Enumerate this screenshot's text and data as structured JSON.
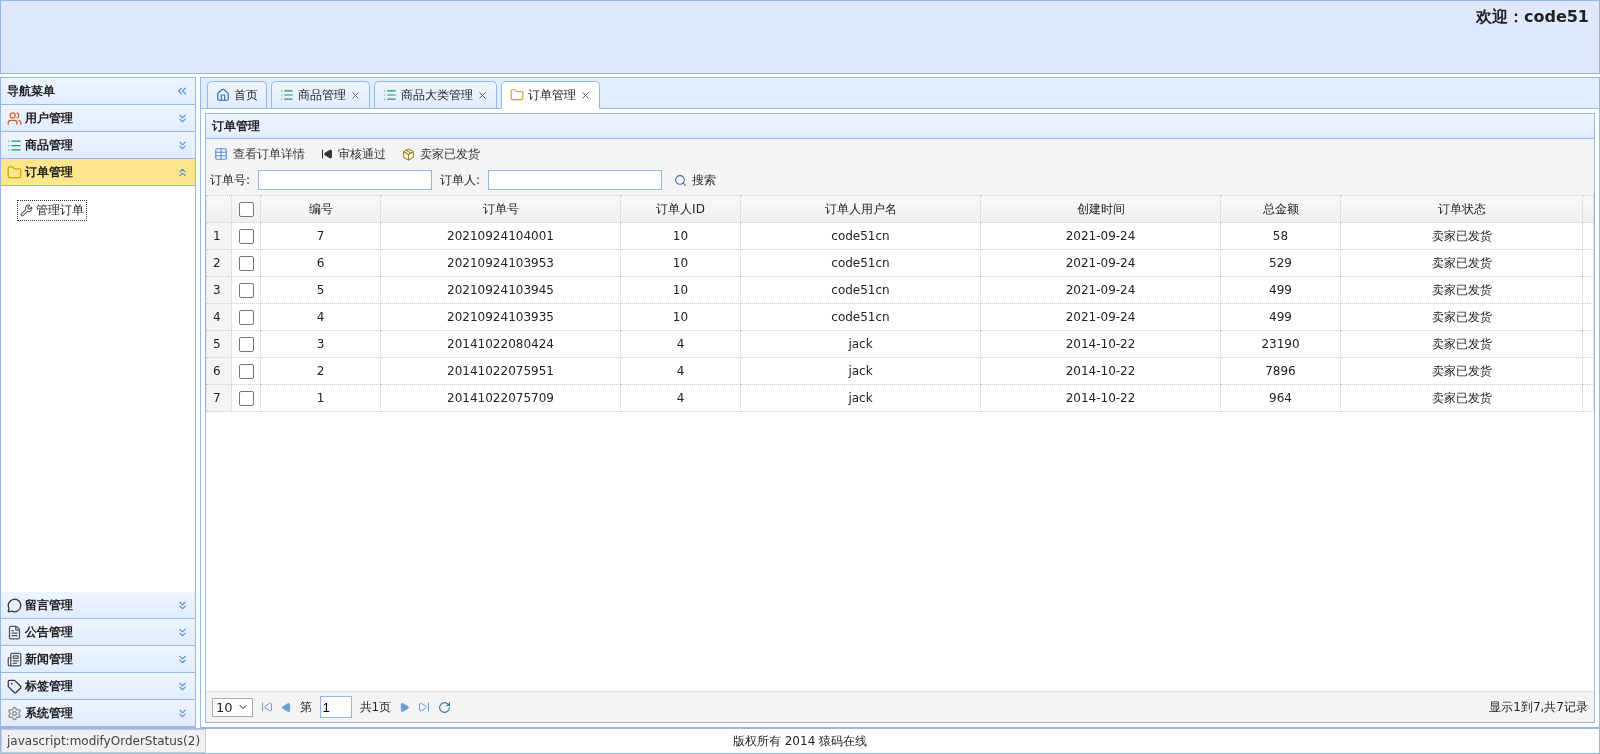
{
  "header": {
    "welcome": "欢迎：code51"
  },
  "sidebar": {
    "title": "导航菜单",
    "sections": [
      {
        "label": "用户管理",
        "expanded": false
      },
      {
        "label": "商品管理",
        "expanded": false
      },
      {
        "label": "订单管理",
        "expanded": true,
        "items": [
          {
            "label": "管理订单",
            "selected": true
          }
        ]
      },
      {
        "label": "留言管理",
        "expanded": false
      },
      {
        "label": "公告管理",
        "expanded": false
      },
      {
        "label": "新闻管理",
        "expanded": false
      },
      {
        "label": "标签管理",
        "expanded": false
      },
      {
        "label": "系统管理",
        "expanded": false
      }
    ]
  },
  "tabs": [
    {
      "label": "首页",
      "selected": false,
      "closable": false
    },
    {
      "label": "商品管理",
      "selected": false,
      "closable": true
    },
    {
      "label": "商品大类管理",
      "selected": false,
      "closable": true
    },
    {
      "label": "订单管理",
      "selected": true,
      "closable": true
    }
  ],
  "panel": {
    "title": "订单管理",
    "toolbar": [
      "查看订单详情",
      "审核通过",
      "卖家已发货"
    ],
    "search": {
      "fields": [
        {
          "label": "订单号:"
        },
        {
          "label": "订单人:"
        }
      ],
      "button": "搜索"
    },
    "table": {
      "header_checked": false,
      "columns": [
        "编号",
        "订单号",
        "订单人ID",
        "订单人用户名",
        "创建时间",
        "总金额",
        "订单状态"
      ],
      "rows": [
        {
          "number": "1",
          "checked": false,
          "cells": [
            "7",
            "20210924104001",
            "10",
            "code51cn",
            "2021-09-24",
            "58",
            "卖家已发货"
          ]
        },
        {
          "number": "2",
          "checked": false,
          "cells": [
            "6",
            "20210924103953",
            "10",
            "code51cn",
            "2021-09-24",
            "529",
            "卖家已发货"
          ]
        },
        {
          "number": "3",
          "checked": false,
          "cells": [
            "5",
            "20210924103945",
            "10",
            "code51cn",
            "2021-09-24",
            "499",
            "卖家已发货"
          ]
        },
        {
          "number": "4",
          "checked": false,
          "cells": [
            "4",
            "20210924103935",
            "10",
            "code51cn",
            "2021-09-24",
            "499",
            "卖家已发货"
          ]
        },
        {
          "number": "5",
          "checked": false,
          "cells": [
            "3",
            "20141022080424",
            "4",
            "jack",
            "2014-10-22",
            "23190",
            "卖家已发货"
          ]
        },
        {
          "number": "6",
          "checked": false,
          "cells": [
            "2",
            "20141022075951",
            "4",
            "jack",
            "2014-10-22",
            "7896",
            "卖家已发货"
          ]
        },
        {
          "number": "7",
          "checked": false,
          "cells": [
            "1",
            "20141022075709",
            "4",
            "jack",
            "2014-10-22",
            "964",
            "卖家已发货"
          ]
        }
      ]
    },
    "pager": {
      "page_size": "10",
      "page_prefix": "第",
      "page": "1",
      "page_suffix": "共1页",
      "summary": "显示1到7,共7记录"
    }
  },
  "status_link": "javascript:modifyOrderStatus(2)",
  "footer": "版权所有 2014 猿码在线"
}
